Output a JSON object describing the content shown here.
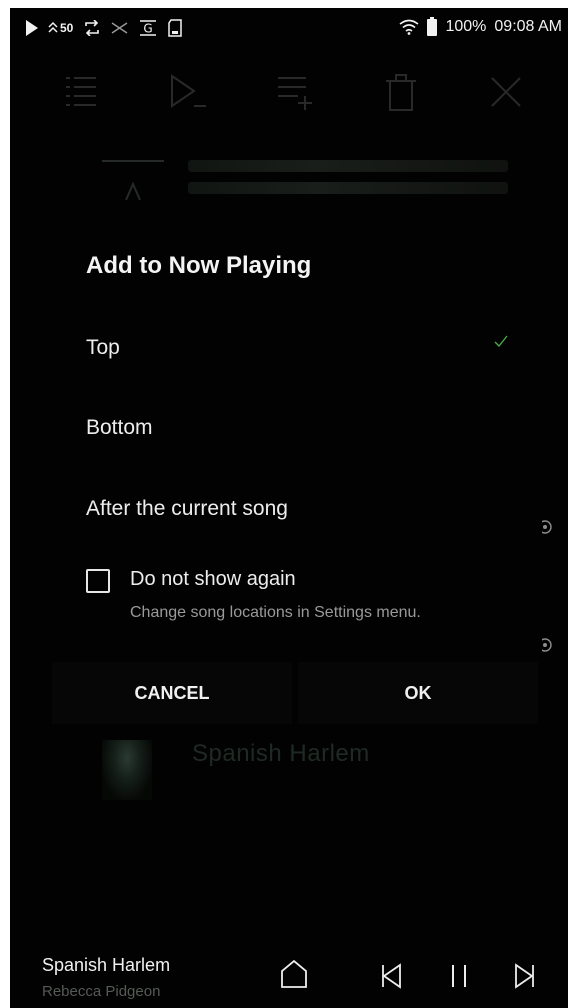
{
  "status_bar": {
    "badge": "50",
    "battery": "100%",
    "time": "09:08 AM",
    "icons": [
      "play-icon",
      "volume-level-icon",
      "repeat-icon",
      "shuffle-icon",
      "gapless-icon",
      "sd-card-icon",
      "wifi-icon",
      "battery-icon"
    ]
  },
  "toolbar": {
    "icons": [
      "playlist-icon",
      "play-next-icon",
      "add-to-playlist-icon",
      "trash-icon",
      "close-icon"
    ]
  },
  "dialog": {
    "title": "Add to Now Playing",
    "options": [
      {
        "label": "Top",
        "selected": true
      },
      {
        "label": "Bottom",
        "selected": false
      },
      {
        "label": "After the current song",
        "selected": false
      }
    ],
    "checkbox_label": "Do not show again",
    "checkbox_checked": false,
    "hint": "Change song locations in Settings menu.",
    "cancel_label": "CANCEL",
    "ok_label": "OK"
  },
  "background": {
    "song_title": "Spanish Harlem"
  },
  "mini_player": {
    "title": "Spanish Harlem",
    "artist": "Rebecca Pidgeon"
  },
  "colors": {
    "accent": "#4caf50",
    "background": "#020202",
    "text": "#ededed"
  }
}
